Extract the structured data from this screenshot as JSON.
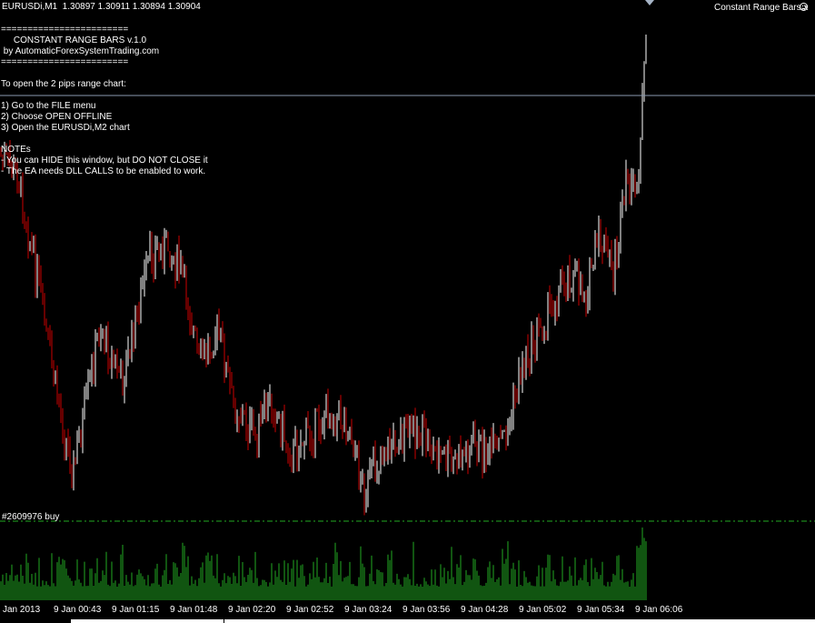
{
  "window": {
    "symbol_info": "EURUSDi,M1  1.30897 1.30911 1.30894 1.30904",
    "indicator_name": "Constant Range Bars",
    "indicator_close": "x"
  },
  "comment_panel": {
    "lines": [
      "========================",
      "     CONSTANT RANGE BARS v.1.0",
      " by AutomaticForexSystemTrading.com",
      "========================",
      "",
      "To open the 2 pips range chart:",
      "",
      "1) Go to the FILE menu",
      "2) Choose OPEN OFFLINE",
      "3) Open the EURUSDi,M2 chart",
      "",
      "NOTEs",
      "- You can HIDE this window, but DO NOT CLOSE it",
      "- The EA needs DLL CALLS to be enabled to work."
    ]
  },
  "order_label": "#2609976 buy",
  "time_axis": [
    "Jan 2013",
    "9 Jan 00:43",
    "9 Jan 01:15",
    "9 Jan 01:48",
    "9 Jan 02:20",
    "9 Jan 02:52",
    "9 Jan 03:24",
    "9 Jan 03:56",
    "9 Jan 04:28",
    "9 Jan 05:02",
    "9 Jan 05:34",
    "9 Jan 06:06"
  ],
  "colors": {
    "background": "#000000",
    "bull_candle": "#ffffff",
    "bear_candle": "#cc0000",
    "volume": "#22aa22",
    "order_line": "#22aa22",
    "bid_line": "#8a9ab0",
    "text": "#ffffff"
  },
  "icons": [
    "smiley-icon",
    "scroll-arrow-icon",
    "close-icon"
  ]
}
